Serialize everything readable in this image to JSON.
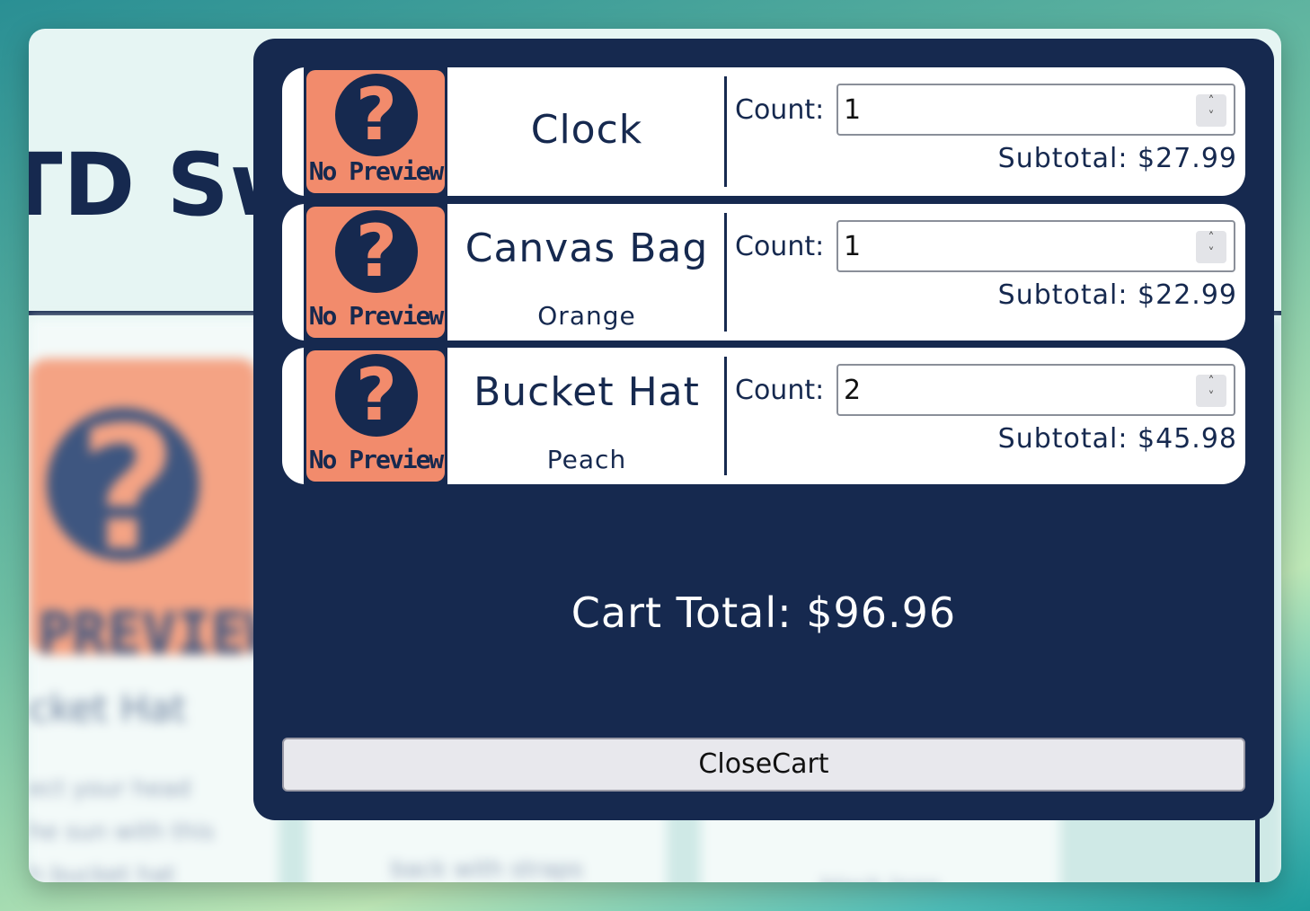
{
  "background_page": {
    "title": "TD Sw",
    "cards": [
      {
        "preview_text": "PREVIEW",
        "name": "cket Hat",
        "description": "ect your head\nhe sun with this\nh bucket hat"
      },
      {
        "preview_text": "",
        "name": "",
        "description": "back with straps"
      },
      {
        "preview_text": "",
        "name": "",
        "description": "black logo"
      }
    ]
  },
  "cart": {
    "count_label": "Count:",
    "subtotal_label": "Subtotal:",
    "items": [
      {
        "preview_text": "No Preview",
        "icon": "question-mark-icon",
        "name": "Clock",
        "variant": "",
        "count": "1",
        "subtotal": "$27.99"
      },
      {
        "preview_text": "No Preview",
        "icon": "question-mark-icon",
        "name": "Canvas Bag",
        "variant": "Orange",
        "count": "1",
        "subtotal": "$22.99"
      },
      {
        "preview_text": "No Preview",
        "icon": "question-mark-icon",
        "name": "Bucket Hat",
        "variant": "Peach",
        "count": "2",
        "subtotal": "$45.98"
      }
    ],
    "total_label": "Cart Total:",
    "total": "$96.96",
    "close_label": "CloseCart"
  },
  "colors": {
    "navy": "#16294f",
    "salmon": "#f28b6c",
    "window_bg": "#e6f5f3"
  }
}
